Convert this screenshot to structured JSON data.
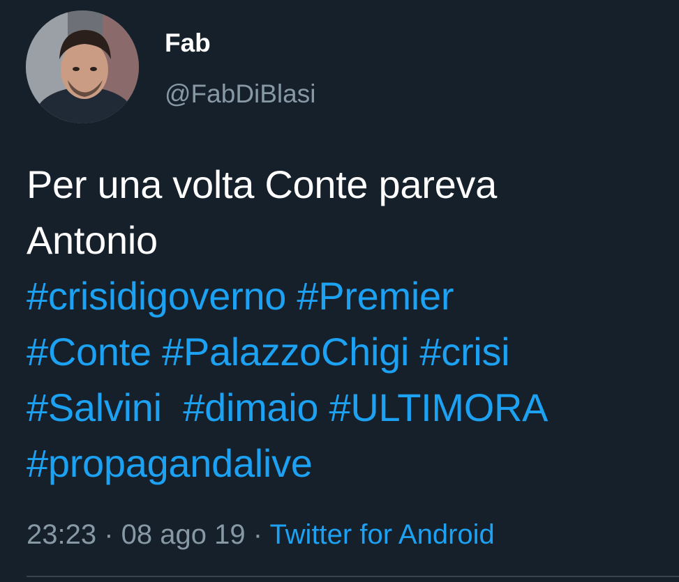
{
  "user": {
    "display_name": "Fab",
    "handle": "@FabDiBlasi"
  },
  "tweet": {
    "text_line_1": "Per una volta Conte pareva",
    "text_line_2": "Antonio",
    "hashtags_line_1": [
      "#crisidigoverno",
      "#Premier"
    ],
    "hashtags_line_2": [
      "#Conte",
      "#PalazzoChigi",
      "#crisi"
    ],
    "hashtags_line_3": [
      "#Salvini",
      "#dimaio",
      "#ULTIMORA"
    ],
    "hashtags_line_4": [
      "#propagandalive"
    ]
  },
  "meta": {
    "time": "23:23",
    "separator": " · ",
    "date": "08 ago 19",
    "source": "Twitter for Android"
  },
  "colors": {
    "background": "#15202b",
    "link": "#1da1f2",
    "secondary_text": "#8899a6",
    "primary_text": "#ffffff"
  }
}
